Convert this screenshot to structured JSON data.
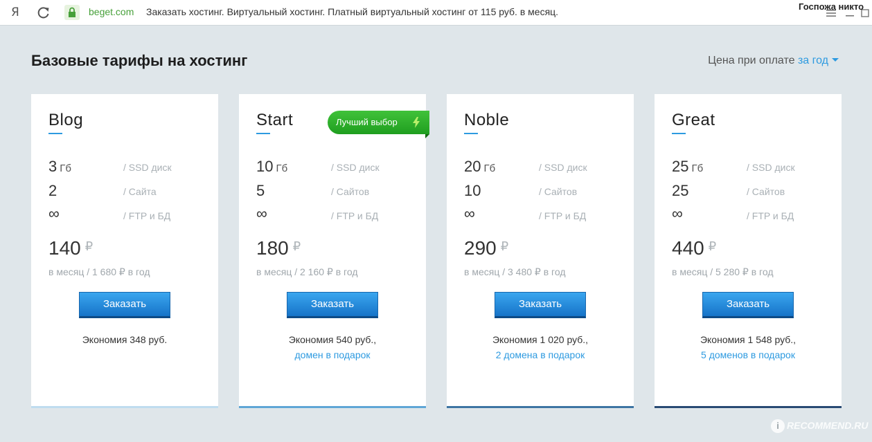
{
  "browser": {
    "logo": "Я",
    "domain": "beget.com",
    "page_title": "Заказать хостинг. Виртуальный хостинг. Платный виртуальный хостинг от 115 руб. в месяц.",
    "profile_name": "Госпожа никто"
  },
  "header": {
    "title": "Базовые тарифы на хостинг",
    "price_prefix": "Цена при оплате",
    "period": "за год"
  },
  "plans": [
    {
      "name": "Blog",
      "disk": "3",
      "disk_unit": "Гб",
      "disk_label": "/ SSD диск",
      "sites": "2",
      "sites_label": "/ Сайта",
      "ftp": "∞",
      "ftp_label": "/ FTP и БД",
      "price": "140",
      "currency": "₽",
      "price_note": "в месяц / 1 680 ₽ в год",
      "order_label": "Заказать",
      "savings": "Экономия 348 руб.",
      "gift": "",
      "bottom_color": "#bfdcef"
    },
    {
      "name": "Start",
      "badge": "Лучший выбор",
      "disk": "10",
      "disk_unit": "Гб",
      "disk_label": "/ SSD диск",
      "sites": "5",
      "sites_label": "/ Сайтов",
      "ftp": "∞",
      "ftp_label": "/ FTP и БД",
      "price": "180",
      "currency": "₽",
      "price_note": "в месяц / 2 160 ₽ в год",
      "order_label": "Заказать",
      "savings": "Экономия 540 руб.,",
      "gift": "домен в подарок",
      "bottom_color": "#5fa6d6"
    },
    {
      "name": "Noble",
      "disk": "20",
      "disk_unit": "Гб",
      "disk_label": "/ SSD диск",
      "sites": "10",
      "sites_label": "/ Сайтов",
      "ftp": "∞",
      "ftp_label": "/ FTP и БД",
      "price": "290",
      "currency": "₽",
      "price_note": "в месяц / 3 480 ₽ в год",
      "order_label": "Заказать",
      "savings": "Экономия 1 020 руб.,",
      "gift": "2 домена в подарок",
      "bottom_color": "#3d74a3"
    },
    {
      "name": "Great",
      "disk": "25",
      "disk_unit": "Гб",
      "disk_label": "/ SSD диск",
      "sites": "25",
      "sites_label": "/ Сайтов",
      "ftp": "∞",
      "ftp_label": "/ FTP и БД",
      "price": "440",
      "currency": "₽",
      "price_note": "в месяц / 5 280 ₽ в год",
      "order_label": "Заказать",
      "savings": "Экономия 1 548 руб.,",
      "gift": "5 доменов в подарок",
      "bottom_color": "#284a73"
    }
  ],
  "watermark": {
    "badge": "i",
    "text": "RECOMMEND.RU"
  }
}
